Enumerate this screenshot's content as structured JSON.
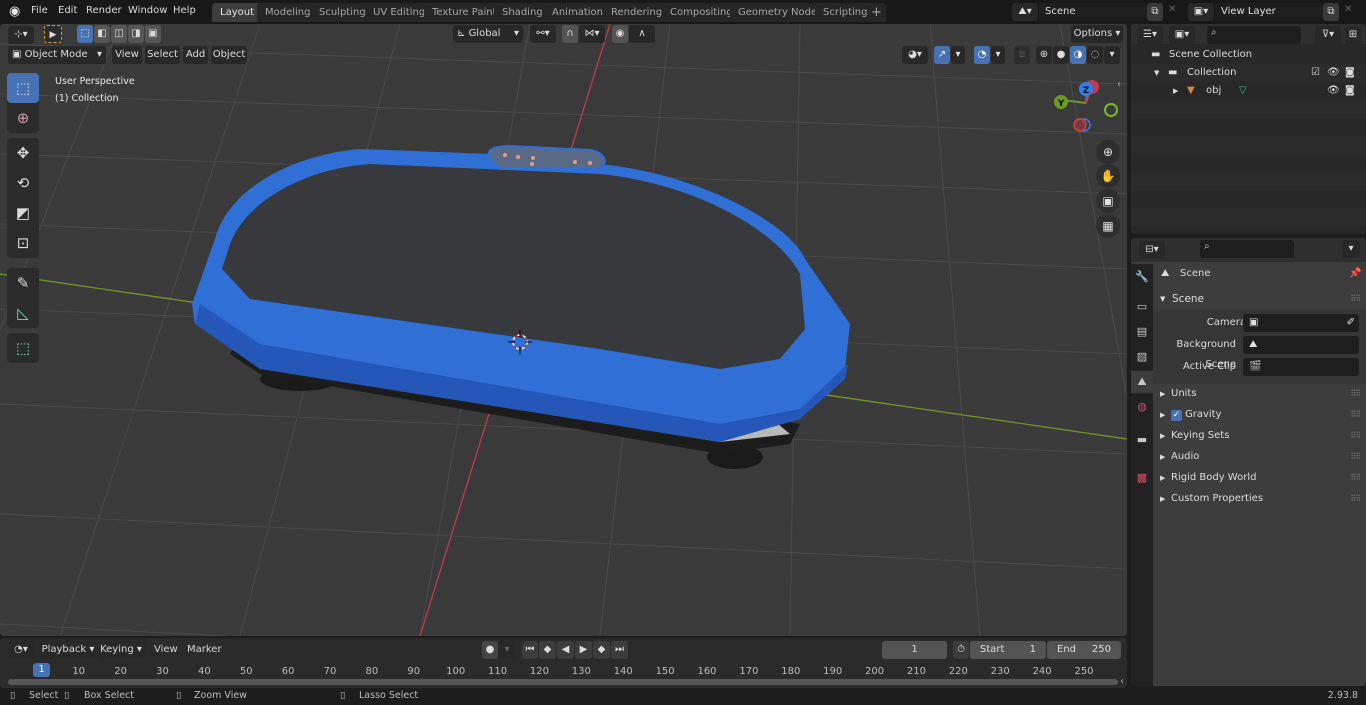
{
  "app": {
    "version": "2.93.8"
  },
  "menu": [
    "File",
    "Edit",
    "Render",
    "Window",
    "Help"
  ],
  "workspaces": [
    {
      "label": "Layout",
      "active": true
    },
    {
      "label": "Modeling"
    },
    {
      "label": "Sculpting"
    },
    {
      "label": "UV Editing"
    },
    {
      "label": "Texture Paint"
    },
    {
      "label": "Shading"
    },
    {
      "label": "Animation"
    },
    {
      "label": "Rendering"
    },
    {
      "label": "Compositing"
    },
    {
      "label": "Geometry Nodes"
    },
    {
      "label": "Scripting"
    }
  ],
  "add_workspace": "+",
  "scene_selector": {
    "value": "Scene"
  },
  "view_layer_selector": {
    "value": "View Layer"
  },
  "viewport": {
    "mode": "Object Mode",
    "header_menus": [
      "View",
      "Select",
      "Add",
      "Object"
    ],
    "transform_orientation": "Global",
    "options_label": "Options",
    "overlay_text": [
      "User Perspective",
      "(1) Collection"
    ],
    "gizmo_axes": [
      "X",
      "Y",
      "Z"
    ],
    "colors": {
      "bg": "#3a3a3a",
      "grid": "#4a4a4a",
      "x_axis": "#c23a4d",
      "y_axis": "#6e9a24",
      "object": "#2f6fd6"
    }
  },
  "toolbox": [
    {
      "name": "select-box-tool",
      "icon": "select-box-icon",
      "active": true
    },
    {
      "name": "cursor-tool",
      "icon": "cursor-icon"
    },
    {
      "name": "move-tool",
      "icon": "move-icon"
    },
    {
      "name": "rotate-tool",
      "icon": "rotate-icon"
    },
    {
      "name": "scale-tool",
      "icon": "scale-icon"
    },
    {
      "name": "transform-tool",
      "icon": "transform-icon"
    },
    {
      "name": "annotate-tool",
      "icon": "annotate-icon"
    },
    {
      "name": "measure-tool",
      "icon": "measure-icon"
    },
    {
      "name": "add-cube-tool",
      "icon": "add-cube-icon"
    }
  ],
  "outliner": {
    "search_placeholder": "",
    "rows": [
      {
        "label": "Scene Collection",
        "level": 0
      },
      {
        "label": "Collection",
        "level": 1
      },
      {
        "label": "obj",
        "level": 2
      }
    ]
  },
  "properties": {
    "search_placeholder": "",
    "context": "Scene",
    "panel_title": "Scene",
    "fields": [
      {
        "label": "Camera",
        "value": ""
      },
      {
        "label": "Background Scene",
        "value": ""
      },
      {
        "label": "Active Clip",
        "value": ""
      }
    ],
    "collapsed_panels": [
      {
        "label": "Units"
      },
      {
        "label": "Gravity",
        "checkbox": true,
        "checked": true
      },
      {
        "label": "Keying Sets"
      },
      {
        "label": "Audio"
      },
      {
        "label": "Rigid Body World"
      },
      {
        "label": "Custom Properties"
      }
    ],
    "tabs": [
      "tool-tab",
      "render-tab",
      "output-tab",
      "view-layer-tab",
      "scene-tab",
      "world-tab",
      "collection-tab",
      "texture-tab"
    ]
  },
  "timeline": {
    "menus": [
      "Playback",
      "Keying",
      "View",
      "Marker"
    ],
    "current_frame": "1",
    "start_label": "Start",
    "start": "1",
    "end_label": "End",
    "end": "250",
    "ticks": [
      "10",
      "20",
      "30",
      "40",
      "50",
      "60",
      "70",
      "80",
      "90",
      "100",
      "110",
      "120",
      "130",
      "140",
      "150",
      "160",
      "170",
      "180",
      "190",
      "200",
      "210",
      "220",
      "230",
      "240",
      "250"
    ],
    "playhead": "1"
  },
  "statusbar": {
    "items": [
      "Select",
      "Box Select",
      "Zoom View",
      "Lasso Select"
    ]
  }
}
